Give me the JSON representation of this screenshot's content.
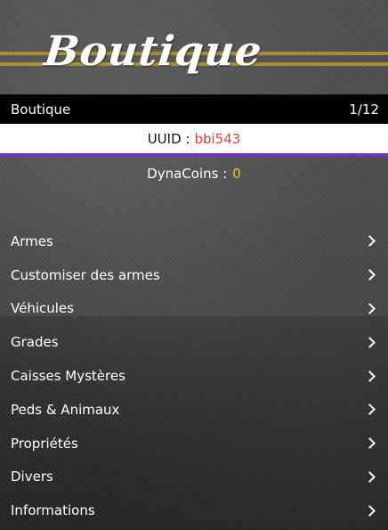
{
  "banner": {
    "title": "Boutique"
  },
  "subheader": {
    "title": "Boutique",
    "counter": "1/12"
  },
  "uuid": {
    "label": "UUID :",
    "value": "bbi543"
  },
  "coins": {
    "label": "DynaCoins :",
    "value": "0"
  },
  "menu": {
    "items": [
      {
        "label": "Armes",
        "icon": "chevron-right-icon"
      },
      {
        "label": "Customiser des armes",
        "icon": "chevron-right-icon"
      },
      {
        "label": "Véhicules",
        "icon": "chevron-right-icon"
      },
      {
        "label": "Grades",
        "icon": "chevron-right-icon"
      },
      {
        "label": "Caisses Mystères",
        "icon": "chevron-right-icon"
      },
      {
        "label": "Peds & Animaux",
        "icon": "chevron-right-icon"
      },
      {
        "label": "Propriétés",
        "icon": "chevron-right-icon"
      },
      {
        "label": "Divers",
        "icon": "chevron-right-icon"
      },
      {
        "label": "Informations",
        "icon": "chevron-right-icon"
      }
    ]
  },
  "colors": {
    "accent": "#6f33c8",
    "uuid_value": "#e03c3c",
    "coins_value": "#f0c030",
    "subheader_bg": "#000000"
  }
}
